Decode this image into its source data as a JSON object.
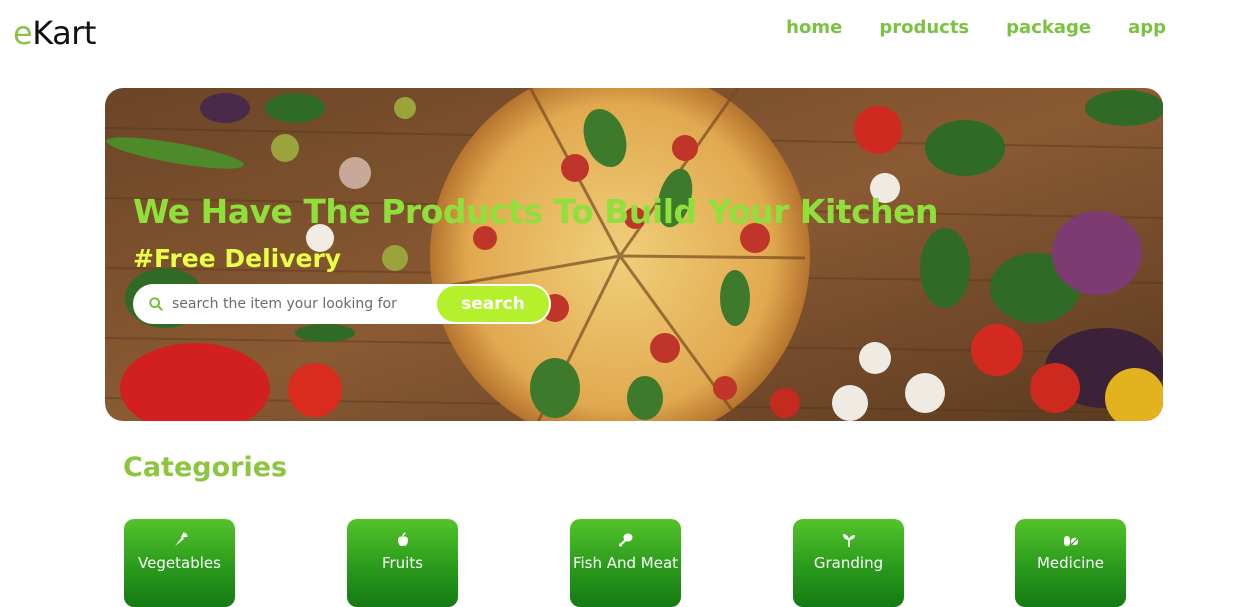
{
  "logo": {
    "prefix": "e",
    "rest": "Kart"
  },
  "nav": [
    {
      "label": "home"
    },
    {
      "label": "products"
    },
    {
      "label": "package"
    },
    {
      "label": "app"
    }
  ],
  "hero": {
    "title": "We Have The Products To Build Your Kitchen",
    "subtitle": "#Free Delivery",
    "search": {
      "placeholder": "search the item your looking for",
      "button_label": "search",
      "icon": "search-icon"
    }
  },
  "categories": {
    "title": "Categories",
    "items": [
      {
        "label": "Vegetables",
        "icon": "carrot-icon"
      },
      {
        "label": "Fruits",
        "icon": "apple-icon"
      },
      {
        "label": "Fish And Meat",
        "icon": "drumstick-icon"
      },
      {
        "label": "Granding",
        "icon": "seedling-icon"
      },
      {
        "label": "Medicine",
        "icon": "pills-icon"
      }
    ]
  },
  "colors": {
    "brand": "#8bc34a",
    "nav": "#7cc242",
    "hero_title": "#8fe03a",
    "hero_sub": "#e8ff4a",
    "search_button": "#b4f02c",
    "category_card": "#2a9a1c"
  }
}
